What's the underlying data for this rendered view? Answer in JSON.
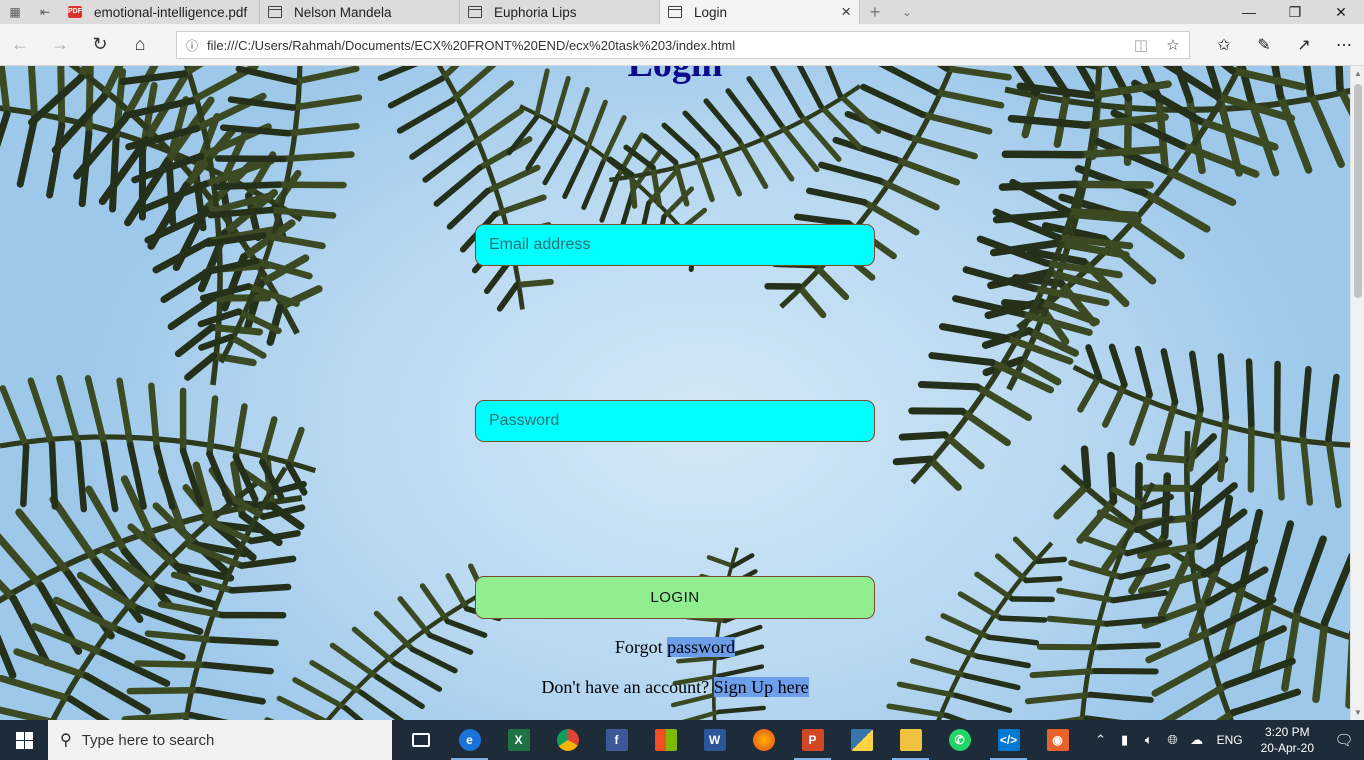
{
  "browser": {
    "tabs": [
      {
        "label": "emotional-intelligence.pdf",
        "favicon": "pdf-icon",
        "active": false
      },
      {
        "label": "Nelson Mandela",
        "favicon": "page-icon",
        "active": false
      },
      {
        "label": "Euphoria Lips",
        "favicon": "page-icon",
        "active": false
      },
      {
        "label": "Login",
        "favicon": "page-icon",
        "active": true
      }
    ],
    "url": "file:///C:/Users/Rahmah/Documents/ECX%20FRONT%20END/ecx%20task%203/index.html"
  },
  "page": {
    "title": "Login",
    "email_placeholder": "Email address",
    "password_placeholder": "Password",
    "login_label": "LOGIN",
    "forgot_prefix": "Forgot ",
    "forgot_link": "password",
    "signup_prefix": "Don't have an account? ",
    "signup_link": "Sign Up here"
  },
  "taskbar": {
    "search_placeholder": "Type here to search",
    "language": "ENG",
    "time": "3:20 PM",
    "date": "20-Apr-20"
  },
  "colors": {
    "input_bg": "#00ffff",
    "button_bg": "#90ee90",
    "title_color": "#0a0a8a",
    "selection": "#6d9eea",
    "taskbar_bg": "#1e2c3a"
  }
}
